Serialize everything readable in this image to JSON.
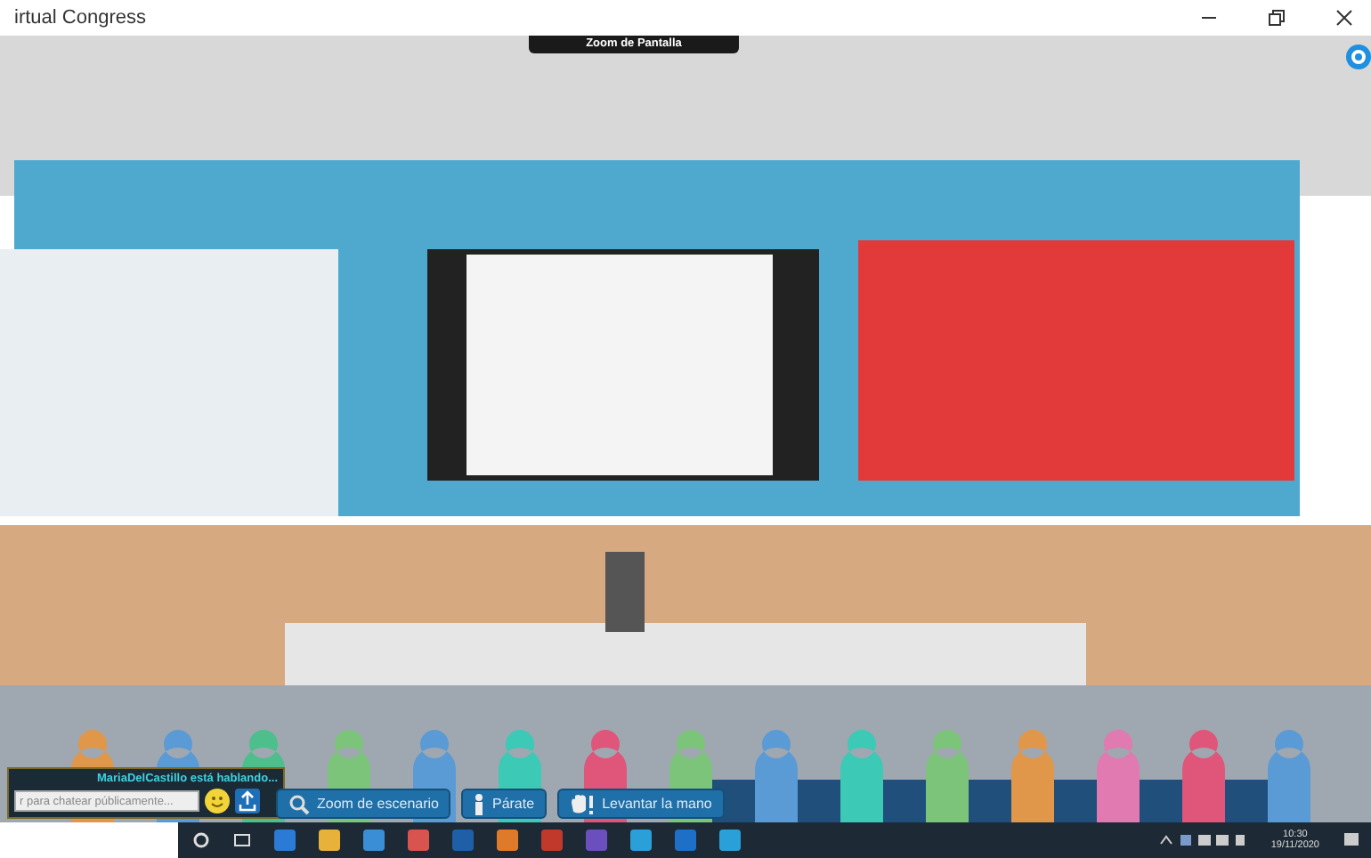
{
  "window": {
    "title": "irtual Congress"
  },
  "screen_zoom_label": "Zoom de Pantalla",
  "chat": {
    "status": "MariaDelCastillo está hablando...",
    "placeholder": "r para chatear públicamente..."
  },
  "toolbar": [
    {
      "label": "Zoom de escenario",
      "kind": "zoom"
    },
    {
      "label": "Párate",
      "kind": "stand"
    },
    {
      "label": "Levantar la mano",
      "kind": "hand"
    }
  ],
  "taskbar": {
    "time": "10:30",
    "date": "19/11/2020"
  }
}
